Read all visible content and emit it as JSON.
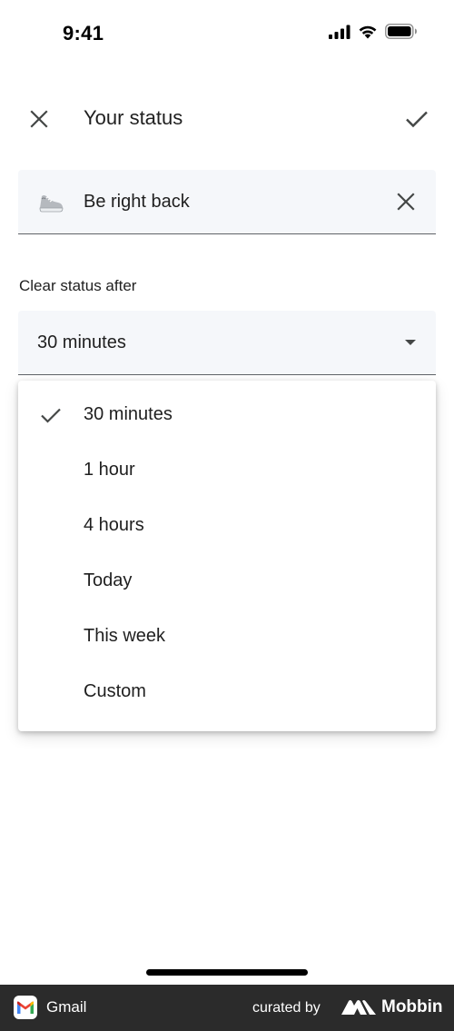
{
  "status_bar": {
    "time": "9:41",
    "icons": [
      "signal-icon",
      "wifi-icon",
      "battery-icon"
    ]
  },
  "header": {
    "title": "Your status",
    "close_icon": "close-icon",
    "confirm_icon": "check-icon"
  },
  "status_field": {
    "emoji": "sneaker-emoji",
    "text": "Be right back",
    "clear_icon": "close-icon"
  },
  "clear_after": {
    "label": "Clear status after",
    "selected": "30 minutes",
    "arrow_icon": "dropdown-arrow-icon"
  },
  "dropdown": {
    "options": [
      {
        "label": "30 minutes",
        "selected": true
      },
      {
        "label": "1 hour",
        "selected": false
      },
      {
        "label": "4 hours",
        "selected": false
      },
      {
        "label": "Today",
        "selected": false
      },
      {
        "label": "This week",
        "selected": false
      },
      {
        "label": "Custom",
        "selected": false
      }
    ]
  },
  "branding": {
    "app_name": "Gmail",
    "curated_by": "curated by",
    "mobbin": "Mobbin"
  },
  "colors": {
    "field_bg": "#f5f7fa",
    "underline": "#5f6368",
    "text": "#1f1f1f",
    "brand_bar": "#2b2b2b"
  }
}
